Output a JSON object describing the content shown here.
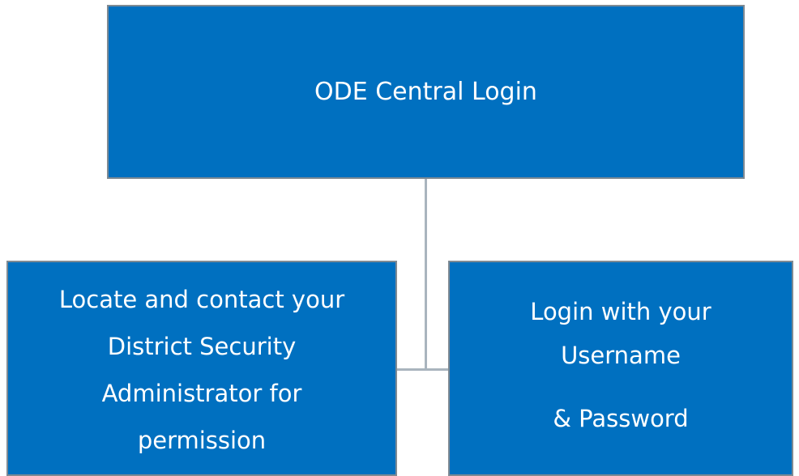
{
  "diagram": {
    "top_node": {
      "label": "ODE Central Login"
    },
    "left_node": {
      "lines": [
        "Locate and contact your",
        "District Security",
        "Administrator for",
        "permission"
      ]
    },
    "right_node": {
      "lines": [
        "Login with your",
        "Username",
        "& Password"
      ]
    },
    "colors": {
      "node_fill": "#0070c0",
      "node_border": "#7f8a93",
      "connector": "#a9b4be",
      "text": "#ffffff"
    }
  }
}
